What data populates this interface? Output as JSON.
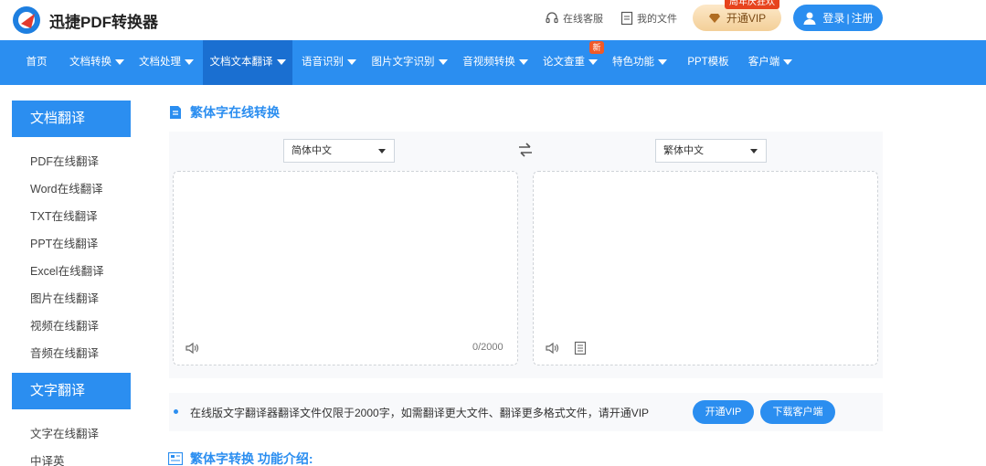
{
  "header": {
    "brand": "迅捷PDF转换器",
    "service": "在线客服",
    "my_files": "我的文件",
    "vip_label": "开通VIP",
    "vip_tag": "周年庆狂欢",
    "login": "登录",
    "register": "注册",
    "divider": "|"
  },
  "nav": {
    "items": [
      "首页",
      "文档转换",
      "文档处理",
      "文档文本翻译",
      "语音识别",
      "图片文字识别",
      "音视频转换",
      "论文查重",
      "特色功能",
      "PPT模板",
      "客户端"
    ],
    "new_tag": "新"
  },
  "sidebar": {
    "groups": [
      {
        "title": "文档翻译",
        "items": [
          "PDF在线翻译",
          "Word在线翻译",
          "TXT在线翻译",
          "PPT在线翻译",
          "Excel在线翻译",
          "图片在线翻译",
          "视频在线翻译",
          "音频在线翻译"
        ]
      },
      {
        "title": "文字翻译",
        "items": [
          "文字在线翻译",
          "中译英"
        ]
      }
    ]
  },
  "main": {
    "title": "繁体字在线转换",
    "source_lang": "简体中文",
    "target_lang": "繁体中文",
    "counter": "0/2000",
    "notice": "在线版文字翻译器翻译文件仅限于2000字，如需翻译更大文件、翻译更多格式文件，请开通VIP",
    "vip_button": "开通VIP",
    "download_button": "下载客户端",
    "intro_title": "繁体字转换 功能介绍:"
  },
  "colors": {
    "primary": "#2b8ef0",
    "nav_active": "#1a6fd1",
    "tag_red": "#e7431d"
  },
  "icons": [
    "logo-icon",
    "headset-icon",
    "file-icon",
    "diamond-icon",
    "user-icon",
    "document-icon",
    "swap-icon",
    "speaker-icon",
    "copy-icon",
    "list-icon"
  ]
}
